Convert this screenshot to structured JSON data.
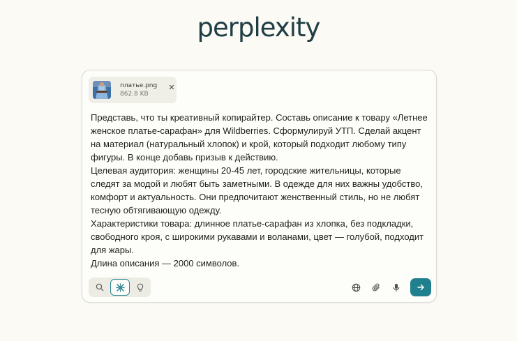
{
  "logo": {
    "text": "perplexity"
  },
  "attachment": {
    "filename": "платье.png",
    "size": "862.8 KB",
    "remove_icon": "close-icon"
  },
  "prompt": {
    "lines": [
      "Представь, что ты креативный копирайтер. Составь описание к товару «Летнее",
      "женское платье-сарафан» для Wildberries. Сформулируй УТП. Сделай акцент",
      "на материал (натуральный хлопок) и крой, который подходит любому типу",
      "фигуры. В конце добавь призыв к действию.",
      "Целевая аудитория: женщины 20-45 лет, городские жительницы, которые",
      "следят за модой и любят быть заметными. В одежде для них важны удобство,",
      "комфорт и актуальность. Они предпочитают женственный стиль, но не любят",
      "тесную обтягивающую одежду.",
      "Характеристики товара: длинное платье-сарафан из хлопка, без подкладки,",
      "свободного кроя, с широкими рукавами и воланами, цвет — голубой, подходит",
      "для жары.",
      "Длина описания — 2000 символов."
    ]
  },
  "modes": [
    {
      "icon": "search-icon",
      "active": false
    },
    {
      "icon": "research-icon",
      "active": true
    },
    {
      "icon": "lightbulb-icon",
      "active": false
    }
  ],
  "tools": [
    "globe-icon",
    "paperclip-icon",
    "microphone-icon"
  ],
  "send": {
    "icon": "arrow-right-icon"
  },
  "colors": {
    "background": "#fbfaf4",
    "logo": "#1f3d44",
    "accent": "#20808d",
    "composer_border": "#d9d9d3"
  }
}
